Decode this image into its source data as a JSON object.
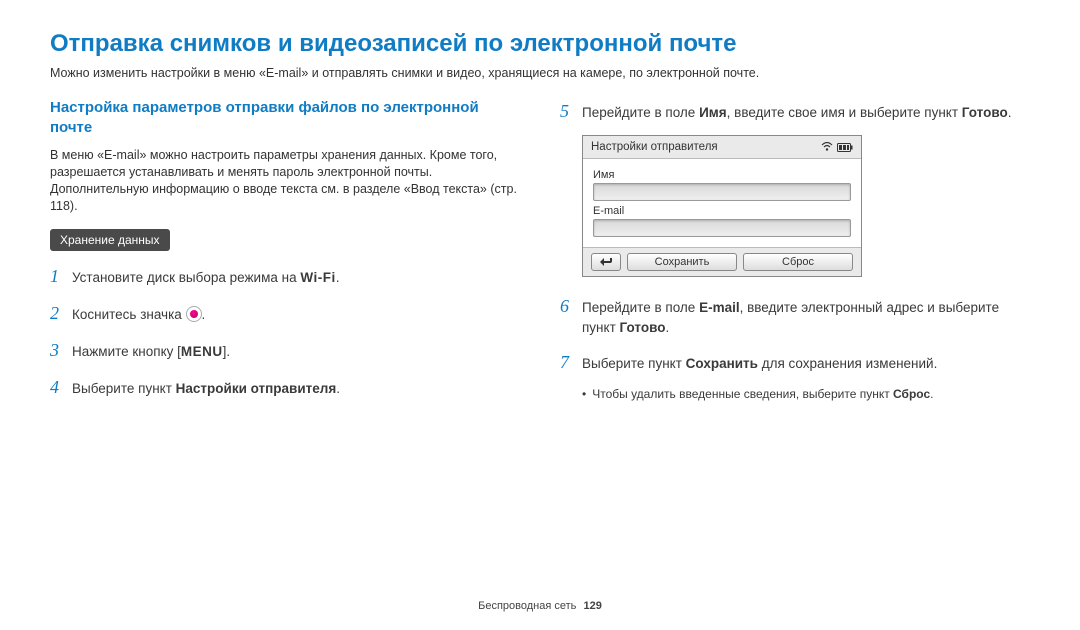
{
  "title": "Отправка снимков и видеозаписей по электронной почте",
  "intro": "Можно изменить настройки в меню «E-mail» и отправлять снимки и видео, хранящиеся на камере, по электронной почте.",
  "left": {
    "section_title": "Настройка параметров отправки файлов по электронной почте",
    "paragraph": "В меню «E-mail» можно настроить параметры хранения данных. Кроме того, разрешается устанавливать и менять пароль электронной почты. Дополнительную информацию о вводе текста см. в разделе «Ввод текста» (стр. 118).",
    "tag": "Хранение данных",
    "step1_pre": "Установите диск выбора режима на ",
    "step1_glyph": "Wi-Fi",
    "step1_post": ".",
    "step2_pre": "Коснитесь значка ",
    "step2_post": ".",
    "step3_pre": "Нажмите кнопку [",
    "step3_glyph": "MENU",
    "step3_post": "].",
    "step4_pre": "Выберите пункт ",
    "step4_bold": "Настройки отправителя",
    "step4_post": "."
  },
  "right": {
    "step5_pre": "Перейдите в поле ",
    "step5_b1": "Имя",
    "step5_mid": ", введите свое имя и выберите пункт ",
    "step5_b2": "Готово",
    "step5_post": ".",
    "ss": {
      "title": "Настройки отправителя",
      "label_name": "Имя",
      "label_email": "E-mail",
      "btn_save": "Сохранить",
      "btn_reset": "Сброс"
    },
    "step6_pre": "Перейдите в поле ",
    "step6_b1": "E-mail",
    "step6_mid": ", введите электронный адрес и выберите пункт ",
    "step6_b2": "Готово",
    "step6_post": ".",
    "step7_pre": "Выберите пункт ",
    "step7_b1": "Сохранить",
    "step7_post": " для сохранения изменений.",
    "bullet_pre": "Чтобы удалить введенные сведения, выберите пункт ",
    "bullet_b": "Сброс",
    "bullet_post": "."
  },
  "footer": {
    "section": "Беспроводная сеть",
    "page": "129"
  }
}
